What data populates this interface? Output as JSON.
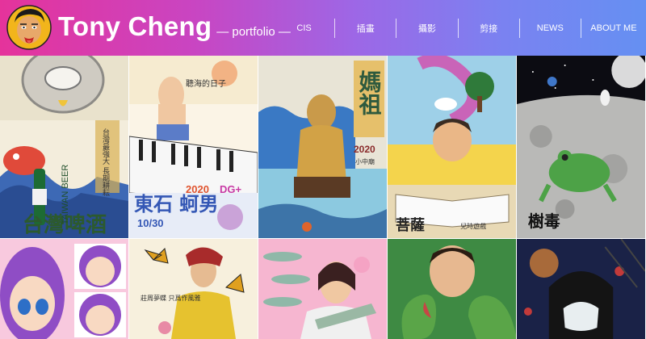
{
  "header": {
    "brand_name": "Tony Cheng",
    "brand_sub": "— portfolio —",
    "nav": [
      {
        "label": "CIS"
      },
      {
        "label": "插畫"
      },
      {
        "label": "攝影"
      },
      {
        "label": "剪接"
      },
      {
        "label": "NEWS"
      },
      {
        "label": "ABOUT ME"
      }
    ]
  },
  "tiles": {
    "t1": {
      "big": "台灣啤酒",
      "latin": "TAIWAN BEER",
      "side": "台灣最強大 長期耕耘"
    },
    "t2": {
      "top": "聽海的日子",
      "big": "東石 蚵男",
      "year": "2020",
      "date": "10/30",
      "tags": "DG+"
    },
    "t3": {
      "big": "媽祖",
      "year": "2020",
      "sub": "小中廟"
    },
    "t4": {
      "big": "菩薩",
      "sub": "兒時遊戲"
    },
    "t5": {
      "big": "樹毒"
    },
    "t6": {},
    "t7": {
      "poem": "莊周夢蝶 只爲作風雅"
    },
    "t8": {},
    "t9": {},
    "t10": {}
  },
  "colors": {
    "header_start": "#e5339b",
    "header_end": "#6590f2"
  }
}
